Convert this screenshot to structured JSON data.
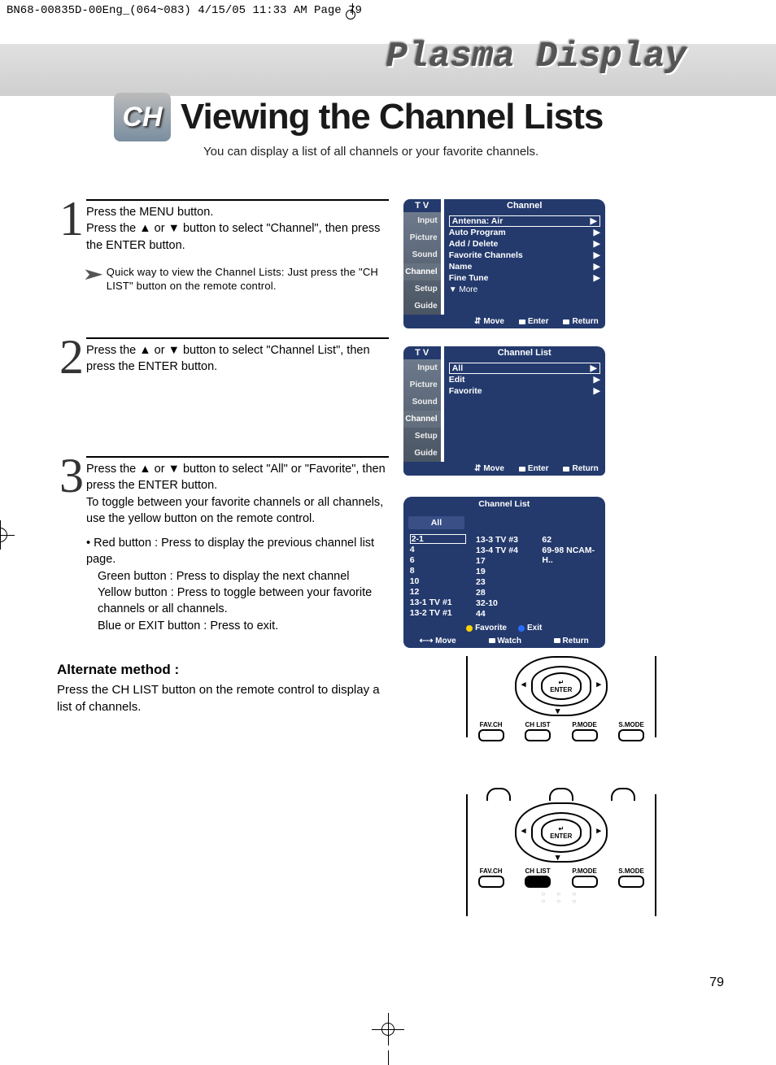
{
  "docHeader": "BN68-00835D-00Eng_(064~083)  4/15/05  11:33 AM  Page 79",
  "bannerTitle": "Plasma Display",
  "chBadge": "CH",
  "pageTitle": "Viewing the Channel Lists",
  "subtitle": "You can display a list of all channels or your favorite channels.",
  "steps": {
    "s1": {
      "num": "1",
      "line1": "Press the MENU button.",
      "line2": "Press the ▲ or ▼ button to select \"Channel\", then press the ENTER button.",
      "hint": "Quick way to view the Channel Lists: Just press the \"CH LIST\" button on the remote control."
    },
    "s2": {
      "num": "2",
      "text": "Press the ▲ or ▼ button to select \"Channel List\", then press the ENTER button."
    },
    "s3": {
      "num": "3",
      "p1": "Press the ▲ or ▼ button to select \"All\" or \"Favorite\", then press the ENTER button.",
      "p2": "To toggle between your favorite channels or all channels, use the yellow button on the remote control.",
      "b1": "• Red button : Press to display the previous channel list page.",
      "b2": "Green button : Press to display the next channel",
      "b3": "Yellow button : Press to toggle between your favorite channels or all channels.",
      "b4": "Blue or EXIT button : Press to exit."
    }
  },
  "osd1": {
    "tv": "T V",
    "title": "Channel",
    "nav": [
      "Input",
      "Picture",
      "Sound",
      "Channel",
      "Setup",
      "Guide"
    ],
    "items": [
      {
        "l": "Antenna",
        "v": ": Air"
      },
      {
        "l": "Auto Program",
        "v": ""
      },
      {
        "l": "Add / Delete",
        "v": ""
      },
      {
        "l": "Favorite Channels",
        "v": ""
      },
      {
        "l": "Name",
        "v": ""
      },
      {
        "l": "Fine Tune",
        "v": ""
      }
    ],
    "more": "▼ More",
    "foot": {
      "move": "Move",
      "enter": "Enter",
      "ret": "Return"
    }
  },
  "osd2": {
    "tv": "T V",
    "title": "Channel List",
    "nav": [
      "Input",
      "Picture",
      "Sound",
      "Channel",
      "Setup",
      "Guide"
    ],
    "items": [
      {
        "l": "All"
      },
      {
        "l": "Edit"
      },
      {
        "l": "Favorite"
      }
    ],
    "foot": {
      "move": "Move",
      "enter": "Enter",
      "ret": "Return"
    }
  },
  "osd3": {
    "title": "Channel List",
    "tag": "All",
    "col1": [
      "2-1",
      "4",
      "6",
      "8",
      "10",
      "12",
      "13-1 TV #1",
      "13-2 TV #1"
    ],
    "col2": [
      "13-3 TV #3",
      "13-4 TV #4",
      "17",
      "19",
      "23",
      "28",
      "32-10",
      "44"
    ],
    "col3": [
      "62",
      "69-98 NCAM-H.."
    ],
    "fav": "Favorite",
    "exit": "Exit",
    "foot": {
      "move": "Move",
      "watch": "Watch",
      "ret": "Return"
    }
  },
  "remote": {
    "enter": "ENTER",
    "enterIcon": "↵",
    "btns": [
      "FAV.CH",
      "CH LIST",
      "P.MODE",
      "S.MODE"
    ]
  },
  "alt": {
    "h": "Alternate method :",
    "p": "Press the CH LIST button on the remote control to display a list of channels."
  },
  "pageNum": "79",
  "icons": {
    "arrowR": "▶",
    "updown": "⇵"
  }
}
